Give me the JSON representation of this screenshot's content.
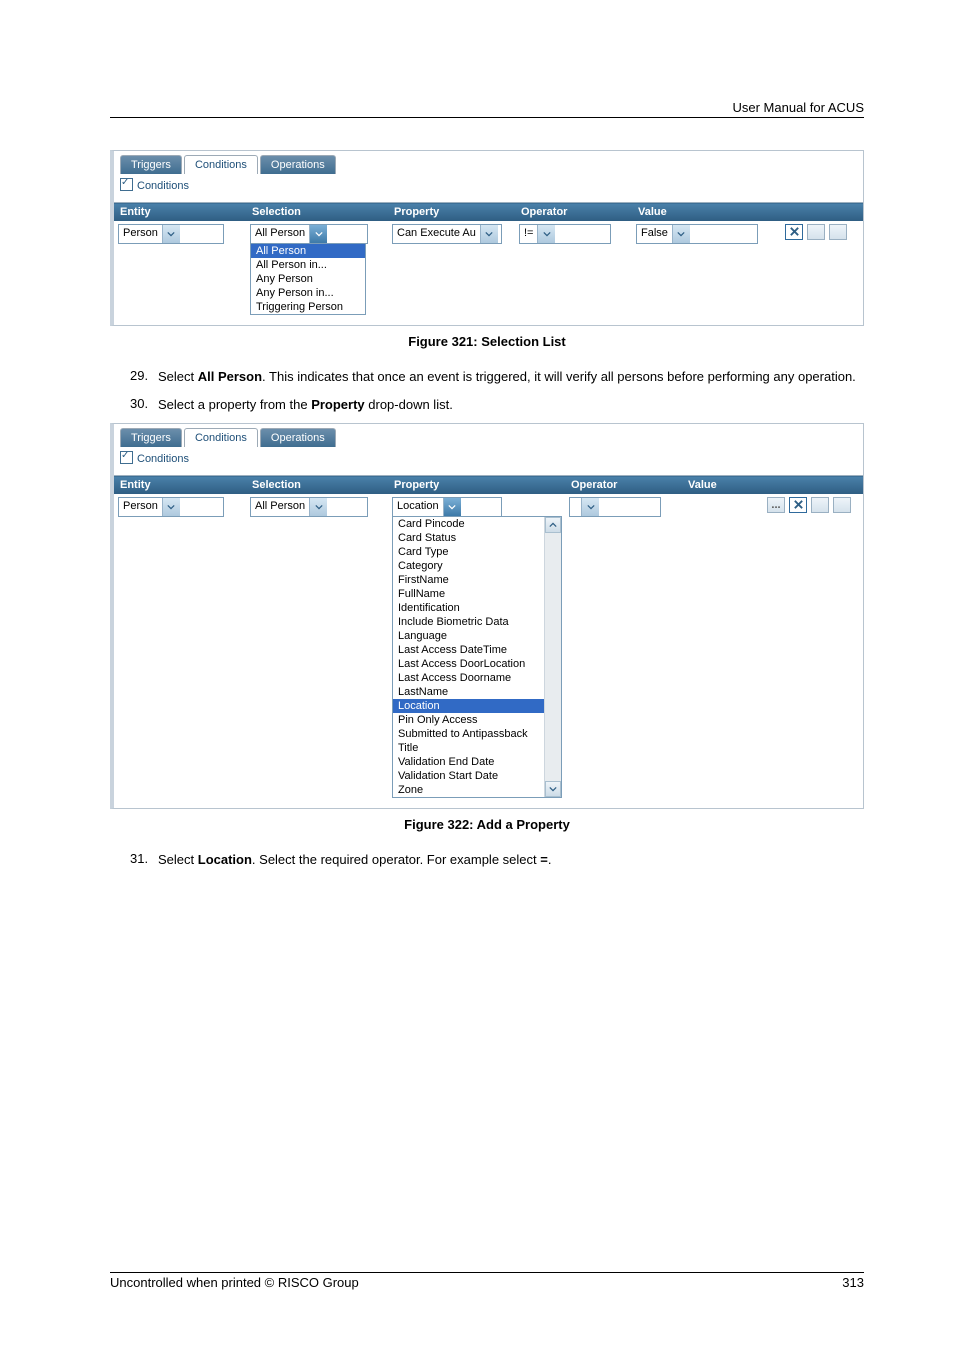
{
  "header": {
    "title": "User Manual for ACUS"
  },
  "footer": {
    "left": "Uncontrolled when printed © RISCO Group",
    "page": "313"
  },
  "tabs": {
    "triggers": "Triggers",
    "conditions": "Conditions",
    "operations": "Operations",
    "conditions_label": "Conditions"
  },
  "columns": {
    "entity": "Entity",
    "selection": "Selection",
    "property": "Property",
    "operator": "Operator",
    "value": "Value"
  },
  "fig1": {
    "caption": "Figure 321: Selection List",
    "entity": "Person",
    "selection": "All Person",
    "selection_options": [
      "All Person",
      "All Person in...",
      "Any Person",
      "Any Person in...",
      "Triggering Person"
    ],
    "property": "Can Execute Au",
    "operator": "!=",
    "value": "False"
  },
  "steps": {
    "s29_num": "29.",
    "s29": "Select All Person. This indicates that once an event is triggered, it will verify all persons before performing any operation.",
    "s29_bold": "All Person",
    "s30_num": "30.",
    "s30": "Select a property from the Property drop-down list.",
    "s30_bold": "Property",
    "s31_num": "31.",
    "s31": "Select Location. Select the required operator. For example select =.",
    "s31_bold1": "Location",
    "s31_bold2": "="
  },
  "fig2": {
    "caption": "Figure 322: Add a Property",
    "entity": "Person",
    "selection": "All Person",
    "property": "Location",
    "property_options": [
      "Card Pincode",
      "Card Status",
      "Card Type",
      "Category",
      "FirstName",
      "FullName",
      "Identification",
      "Include Biometric Data",
      "Language",
      "Last Access DateTime",
      "Last Access DoorLocation",
      "Last Access Doorname",
      "LastName",
      "Location",
      "Pin Only Access",
      "Submitted to Antipassback",
      "Title",
      "Validation End Date",
      "Validation Start Date",
      "Zone"
    ],
    "property_selected": "Location",
    "ellipsis": "..."
  }
}
